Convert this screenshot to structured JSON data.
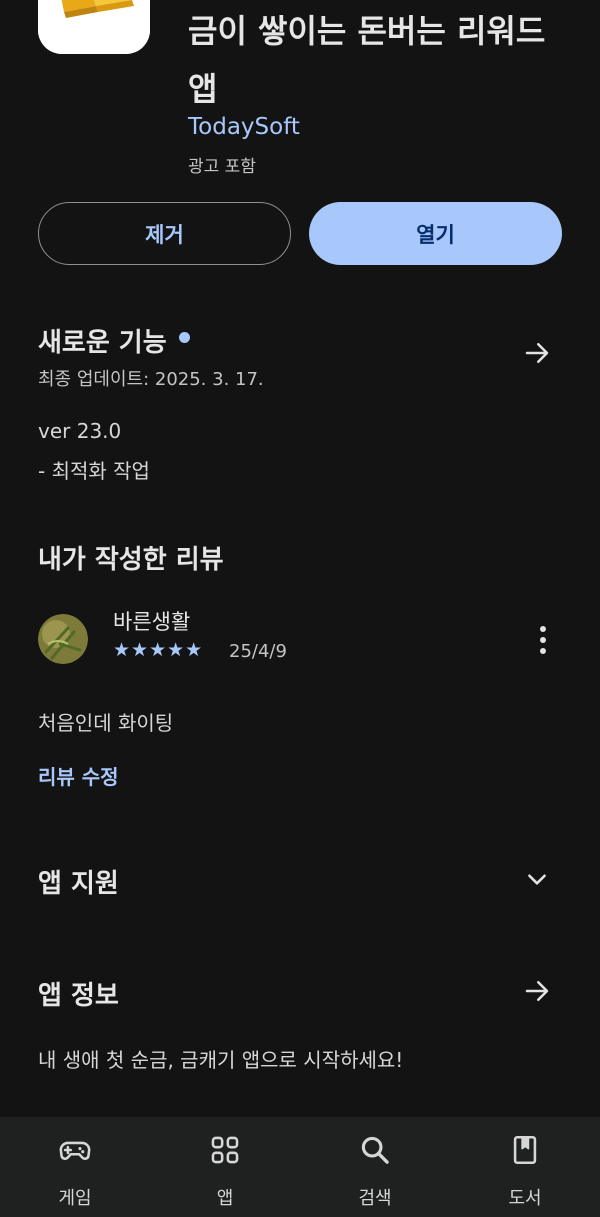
{
  "app": {
    "title": "금이 쌓이는 돈버는 리워드 앱",
    "developer": "TodaySoft",
    "ads_label": "광고 포함"
  },
  "buttons": {
    "remove": "제거",
    "open": "열기"
  },
  "whats_new": {
    "title": "새로운 기능",
    "last_updated": "최종 업데이트: 2025. 3. 17.",
    "version": "ver 23.0",
    "note": "- 최적화 작업"
  },
  "my_review": {
    "title": "내가 작성한 리뷰",
    "reviewer": "바른생활",
    "stars": "★★★★★",
    "rating": 5,
    "date": "25/4/9",
    "text": "처음인데 화이팅",
    "edit_label": "리뷰 수정"
  },
  "app_support": {
    "title": "앱 지원"
  },
  "app_info": {
    "title": "앱 정보",
    "description": "내 생애 첫 순금, 금캐기 앱으로 시작하세요!"
  },
  "nav": {
    "games": "게임",
    "apps": "앱",
    "search": "검색",
    "books": "도서"
  },
  "colors": {
    "background": "#131313",
    "accent": "#a8c7fa",
    "nav_background": "#1f2020"
  }
}
